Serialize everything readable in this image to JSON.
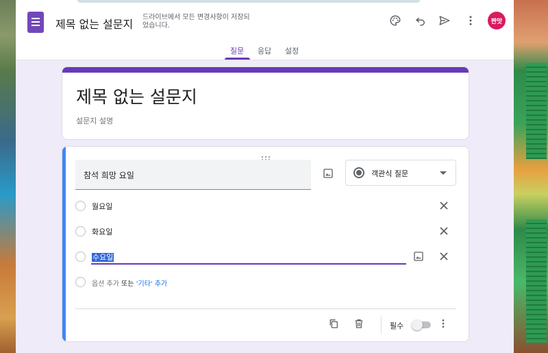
{
  "header": {
    "title": "제목 없는 설문지",
    "save_status": "드라이브에서 모든 변경사항이 저장되었습니다.",
    "avatar_text": "짠맛",
    "icons": [
      "palette-icon",
      "undo-icon",
      "send-icon",
      "more-vert-icon"
    ]
  },
  "tabs": [
    {
      "label": "질문",
      "active": true
    },
    {
      "label": "응답",
      "active": false
    },
    {
      "label": "설정",
      "active": false
    }
  ],
  "form": {
    "title": "제목 없는 설문지",
    "description_placeholder": "설문지 설명"
  },
  "question": {
    "title": "참석 희망 요일",
    "type_label": "객관식 질문",
    "options": [
      "월요일",
      "화요일",
      "수요일"
    ],
    "add_option": "옵션 추가",
    "or_text": "또는",
    "add_other": "'기타' 추가",
    "required_label": "필수",
    "required": false
  },
  "colors": {
    "accent": "#673ab7",
    "question_accent": "#4285f4",
    "background": "#f0ebf8"
  }
}
